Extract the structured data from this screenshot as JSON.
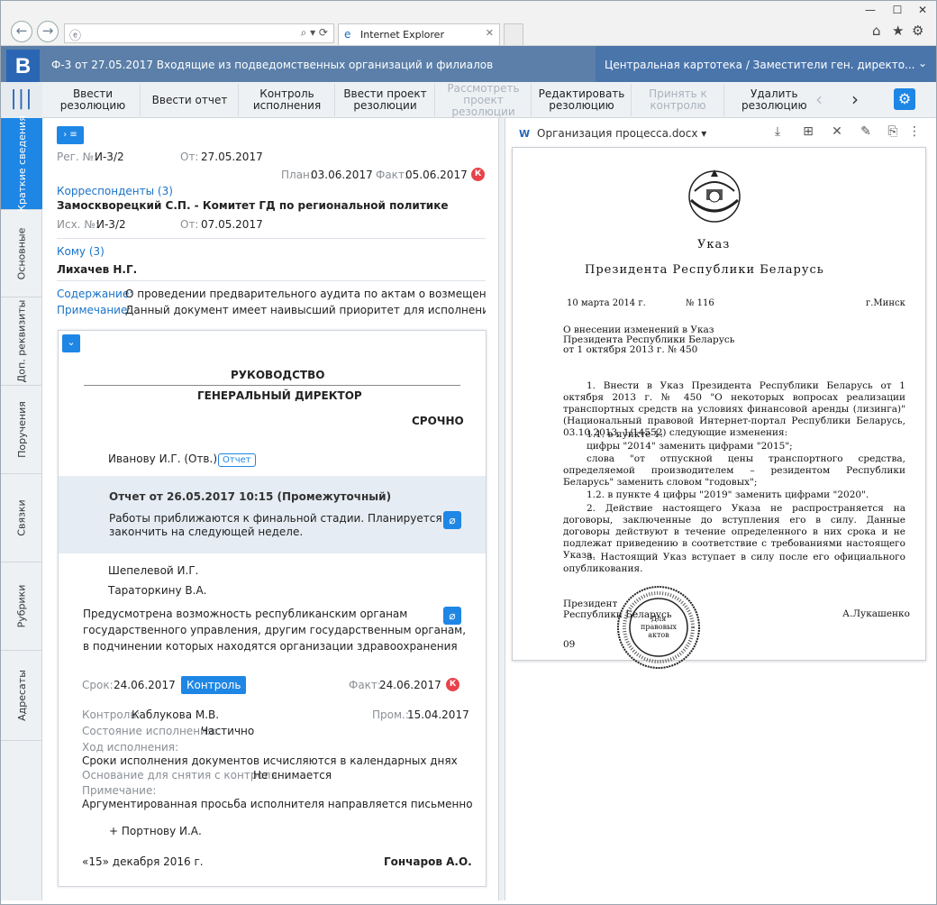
{
  "browser": {
    "tab_title": "Internet Explorer",
    "window_controls": {
      "minimize": "—",
      "maximize": "☐",
      "close": "✕"
    }
  },
  "header": {
    "logo": "B",
    "title": "Ф-3 от 27.05.2017  Входящие из подведомственных организаций и филиалов",
    "context": "Центральная картотека / Заместители ген. директо..."
  },
  "toolbar": {
    "buttons": [
      {
        "label": "Ввести резолюцию",
        "enabled": true
      },
      {
        "label": "Ввести отчет",
        "enabled": true
      },
      {
        "label": "Контроль исполнения",
        "enabled": true
      },
      {
        "label": "Ввести проект резолюции",
        "enabled": true
      },
      {
        "label": "Рассмотреть проект резолюции",
        "enabled": false
      },
      {
        "label": "Редактировать резолюцию",
        "enabled": true
      },
      {
        "label": "Принять к контролю",
        "enabled": false
      },
      {
        "label": "Удалить резолюцию",
        "enabled": true
      }
    ]
  },
  "side_tabs": [
    "Краткие сведения",
    "Основные",
    "Доп. реквизиты",
    "Поручения",
    "Связки",
    "Рубрики",
    "Адресаты"
  ],
  "summary": {
    "reg_label": "Рег. №:",
    "reg_value": "И-3/2",
    "from_label": "От:",
    "from_value": "27.05.2017",
    "plan_label": "План:",
    "plan_value": "03.06.2017",
    "fact_label": "Факт:",
    "fact_value": "05.06.2017",
    "k_badge": "К",
    "correspondents_label": "Корреспонденты (3)",
    "correspondent": "Замоскворецкий С.П. - Комитет ГД по региональной политике",
    "out_label": "Исх. №:",
    "out_value": "И-3/2",
    "out_from_label": "От:",
    "out_from_value": "07.05.2017",
    "to_label": "Кому (3)",
    "to_value": "Лихачев Н.Г.",
    "content_label": "Содержание:",
    "content_value": "О проведении предварительного аудита по актам о возмещения у...",
    "note_label": "Примечание:",
    "note_value": "Данный документ имеет наивысший приоритет для исполнения вс..."
  },
  "resolution": {
    "heading1": "РУКОВОДСТВО",
    "heading2": "ГЕНЕРАЛЬНЫЙ ДИРЕКТОР",
    "urgency": "СРОЧНО",
    "executor": "Иванову И.Г. (Отв.)",
    "report_pill": "Отчет",
    "report_title": "Отчет от 26.05.2017 10:15 (Промежуточный)",
    "report_text_1": "Работы приближаются к финальной стадии. Планируется",
    "report_text_2": "закончить на следующей неделе.",
    "co_exec_1": "Шепелевой И.Г.",
    "co_exec_2": "Тараторкину В.А.",
    "text_1": "Предусмотрена возможность республиканским органам",
    "text_2": "государственного управления, другим государственным органам,",
    "text_3": "в подчинении которых находятся организации здравоохранения",
    "term_label": "Срок:",
    "term_value": "24.06.2017",
    "control_btn": "Контроль",
    "fact_label": "Факт:",
    "fact_value": "24.06.2017",
    "k_badge": "К",
    "controller_label": "Контроль:",
    "controller_value": "Каблукова М.В.",
    "ext_label": "Пром.:",
    "ext_value": "15.04.2017",
    "state_label": "Состояние исполнения:",
    "state_value": "Частично",
    "progress_label": "Ход исполнения:",
    "progress_value": "Сроки исполнения документов исчисляются в календарных днях",
    "removal_label": "Основание для снятия с контроля:",
    "removal_value": "Не снимается",
    "note_label": "Примечание:",
    "note_value": "Аргументированная просьба исполнителя направляется письменно",
    "plus": "+ Портнову И.А.",
    "date": "«15» декабря 2016 г.",
    "signer": "Гончаров А.О."
  },
  "document": {
    "filename": "Организация процесса.docx",
    "title1": "Указ",
    "title2": "Президента Республики Беларусь",
    "date": "10 марта 2014 г.",
    "number": "№ 116",
    "city": "г.Минск",
    "subject_1": "О внесении изменений в Указ",
    "subject_2": "Президента Республики Беларусь",
    "subject_3": "от 1 октября 2013 г. № 450",
    "p1": "1. Внести в Указ Президента Республики Беларусь от 1 октября 2013 г. № 450 \"О некоторых вопросах реализации транспортных средств на условиях финансовой аренды (лизинга)\" (Национальный правовой Интернет-портал Республики Беларусь, 03.10.2013, 1/14552) следующие изменения:",
    "p2": "1.1. в пункте 1:",
    "p3": "цифры \"2014\" заменить цифрами \"2015\";",
    "p4": "слова \"от отпускной цены транспортного средства, определяемой производителем – резидентом Республики Беларусь\" заменить словом \"годовых\";",
    "p5": "1.2. в пункте 4 цифры \"2019\" заменить цифрами \"2020\".",
    "p6": "2. Действие настоящего Указа не распространяется на договоры, заключенные до вступления его в силу. Данные договоры действуют в течение определенного в них срока и не подлежат приведению в соответствие с требованиями настоящего Указа.",
    "p7": "3. Настоящий Указ вступает в силу после его официального опубликования.",
    "sign_left_1": "Президент",
    "sign_left_2": "Республики Беларусь",
    "sign_right": "А.Лукашенко",
    "footer": "09",
    "stamp_text": "Для правовых актов"
  }
}
